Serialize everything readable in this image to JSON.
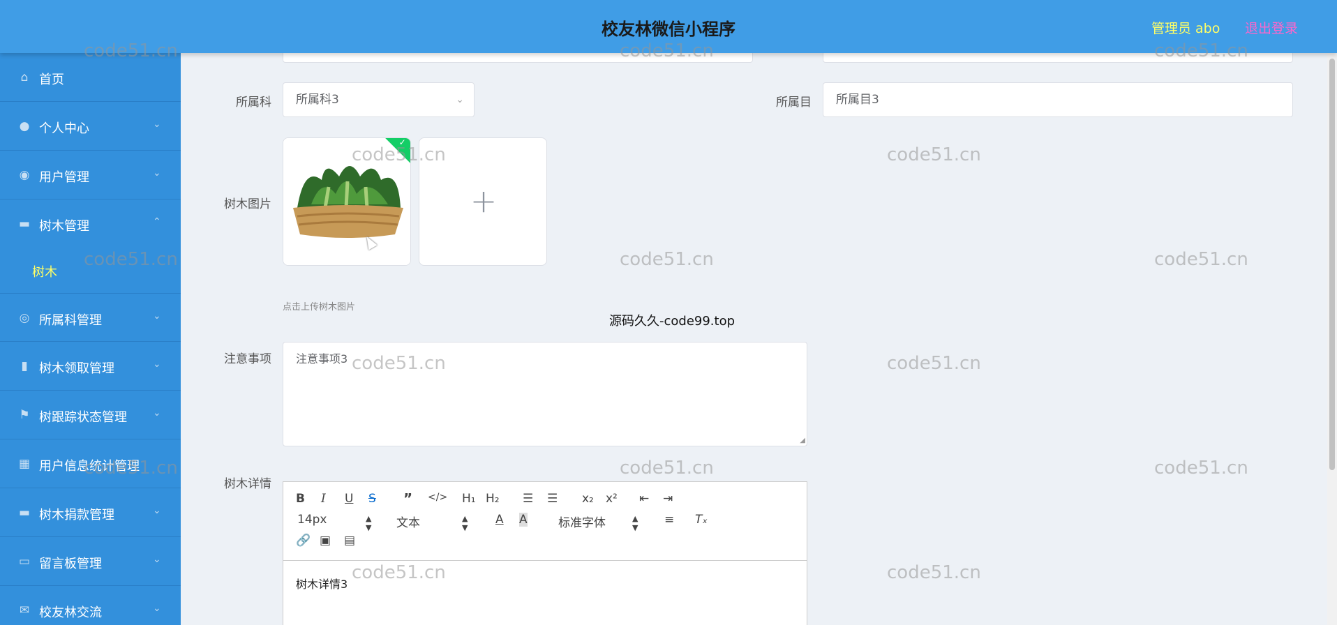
{
  "header": {
    "title": "校友林微信小程序",
    "user": "管理员 abo",
    "logout": "退出登录"
  },
  "sidebar": {
    "items": [
      {
        "label": "首页",
        "icon": "home-icon"
      },
      {
        "label": "个人中心",
        "icon": "person-icon"
      },
      {
        "label": "用户管理",
        "icon": "user-manage-icon"
      },
      {
        "label": "树木管理",
        "icon": "chat-icon"
      },
      {
        "label": "所属科管理",
        "icon": "compass-icon"
      },
      {
        "label": "树木领取管理",
        "icon": "bar-chart-icon"
      },
      {
        "label": "树跟踪状态管理",
        "icon": "flag-icon"
      },
      {
        "label": "用户信息统计管理",
        "icon": "grid-icon"
      },
      {
        "label": "树木捐款管理",
        "icon": "monitor-icon"
      },
      {
        "label": "留言板管理",
        "icon": "message-icon"
      },
      {
        "label": "校友林交流",
        "icon": "mail-icon"
      }
    ],
    "active_sub": "树木"
  },
  "form": {
    "family_label": "所属科",
    "family_value": "所属科3",
    "order_label": "所属目",
    "order_value": "所属目3",
    "image_label": "树木图片",
    "upload_hint": "点击上传树木图片",
    "notes_label": "注意事项",
    "notes_value": "注意事项3",
    "detail_label": "树木详情",
    "detail_value": "树木详情3"
  },
  "editor": {
    "font_size": "14px",
    "format": "文本",
    "font_family": "标准字体"
  },
  "watermark": "code51.cn",
  "banner": "源码久久-code99.top"
}
